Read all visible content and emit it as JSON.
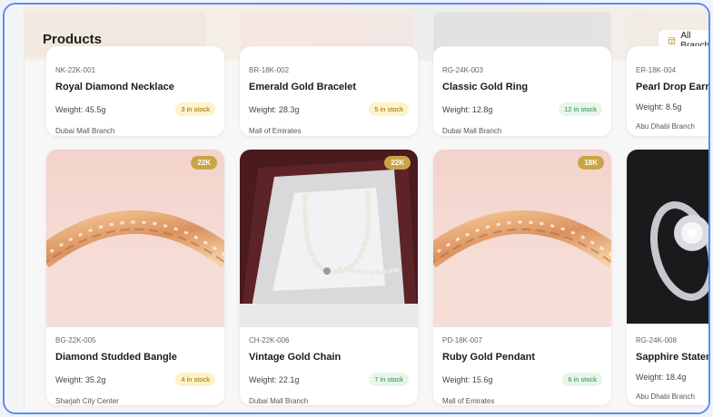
{
  "header": {
    "title": "Products",
    "branch_filter": "All Branches"
  },
  "colors": {
    "accent": "#5b8def",
    "karat_badge": "#c9a446"
  },
  "row1": [
    {
      "sku": "NK-22K-001",
      "name": "Royal Diamond Necklace",
      "weight": "Weight: 45.5g",
      "stock": "3 in stock",
      "branch": "Dubai Mall Branch"
    },
    {
      "sku": "BR-18K-002",
      "name": "Emerald Gold Bracelet",
      "weight": "Weight: 28.3g",
      "stock": "5 in stock",
      "branch": "Mall of Emirates"
    },
    {
      "sku": "RG-24K-003",
      "name": "Classic Gold Ring",
      "weight": "Weight: 12.8g",
      "stock": "12 in stock",
      "branch": "Dubai Mall Branch"
    },
    {
      "sku": "ER-18K-004",
      "name": "Pearl Drop Earrings",
      "weight": "Weight: 8.5g",
      "stock": "",
      "branch": "Abu Dhabi Branch"
    }
  ],
  "row2": [
    {
      "karat": "22K",
      "sku": "BG-22K-005",
      "name": "Diamond Studded Bangle",
      "weight": "Weight: 35.2g",
      "stock": "4 in stock",
      "branch": "Sharjah City Center"
    },
    {
      "karat": "22K",
      "sku": "CH-22K-006",
      "name": "Vintage Gold Chain",
      "weight": "Weight: 22.1g",
      "stock": "7 in stock",
      "branch": "Dubai Mall Branch"
    },
    {
      "karat": "18K",
      "sku": "PD-18K-007",
      "name": "Ruby Gold Pendant",
      "weight": "Weight: 15.6g",
      "stock": "6 in stock",
      "branch": "Mall of Emirates"
    },
    {
      "karat": "",
      "sku": "RG-24K-008",
      "name": "Sapphire Statement Ring",
      "weight": "Weight: 18.4g",
      "stock": "",
      "branch": "Abu Dhabi Branch"
    }
  ]
}
